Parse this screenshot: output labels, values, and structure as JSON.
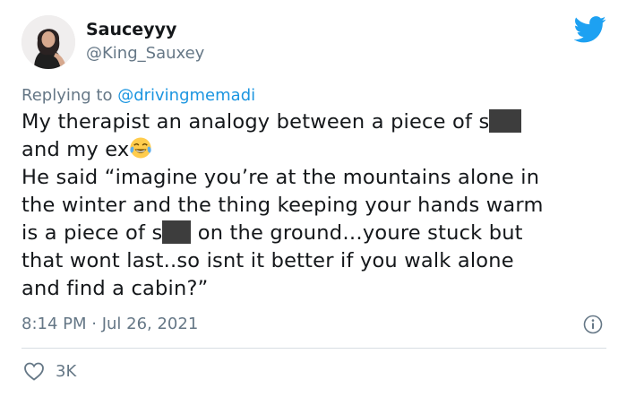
{
  "user": {
    "display_name": "Sauceyyy",
    "handle": "@King_Sauxey"
  },
  "reply": {
    "prefix": "Replying to ",
    "mention": "@drivingmemadi"
  },
  "tweet": {
    "line1_before_redaction": "My therapist an analogy between a piece of s",
    "line2_text": "and my ex",
    "line2_emoji": "face-with-tears-of-joy-icon",
    "line3": "He said “imagine you’re at the mountains alone in",
    "line4": "the winter and the thing keeping your hands warm",
    "line5_before_redaction": "is a piece of s",
    "line5_after_redaction": " on the ground…youre stuck but",
    "line6": "that wont last..so isnt it better if you walk alone",
    "line7": "and find a cabin?”"
  },
  "meta": {
    "timestamp": "8:14 PM · Jul 26, 2021"
  },
  "engagement": {
    "likes": "3K"
  },
  "icons": {
    "brand": "twitter-bird-icon",
    "info": "info-icon",
    "like": "heart-icon"
  },
  "colors": {
    "brand_blue": "#1da1f2",
    "mention_blue": "#1b95e0",
    "secondary_text": "#657786",
    "primary_text": "#14171a",
    "redaction": "#3d3d3d"
  }
}
